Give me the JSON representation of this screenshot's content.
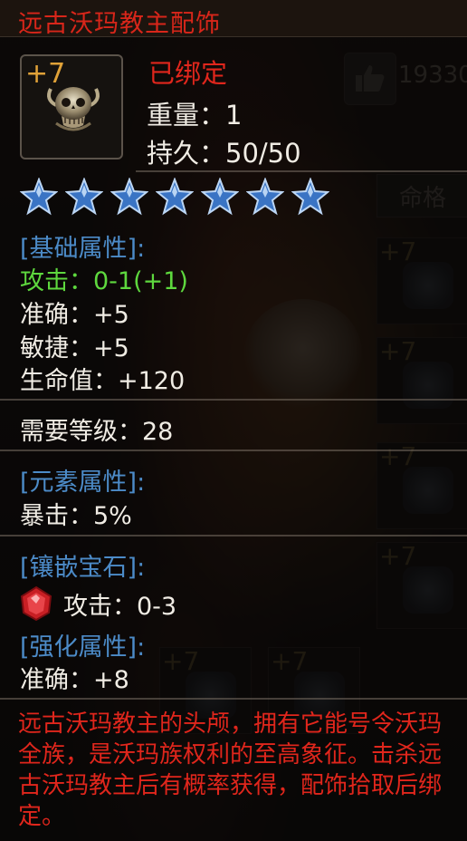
{
  "background": {
    "like_count": "19330",
    "fate_button_label": "命格",
    "slot_levels": [
      "+7",
      "+7",
      "+7",
      "+7",
      "+7",
      "+7"
    ]
  },
  "item": {
    "name": "远古沃玛教主配饰",
    "enhance_level": "+7",
    "icon": "skull-ornament-icon",
    "bind_status": "已绑定",
    "weight": "重量：1",
    "durability": "持久：50/50",
    "stars": 7
  },
  "basic_section": {
    "header": "[基础属性]:",
    "attack": "攻击：0-1(+1)",
    "accuracy": "准确：+5",
    "agility": "敏捷：+5",
    "hp": "生命值：+120"
  },
  "required_level": "需要等级：28",
  "element_section": {
    "header": "[元素属性]:",
    "crit": "暴击：5%"
  },
  "gem_section": {
    "header": "[镶嵌宝石]:",
    "gem_icon": "red-gem-icon",
    "gem_stat": "攻击：0-3"
  },
  "enhance_section": {
    "header": "[强化属性]:",
    "accuracy": "准确：+8"
  },
  "description": "远古沃玛教主的头颅，拥有它能号令沃玛全族，是沃玛族权利的至高象征。击杀远古沃玛教主后有概率获得，配饰拾取后绑定。",
  "colors": {
    "title_red": "#d8261a",
    "section_blue": "#4c8bc8",
    "bonus_green": "#5ed83e",
    "level_gold": "#e0a238",
    "text_white": "#f0ece4"
  }
}
